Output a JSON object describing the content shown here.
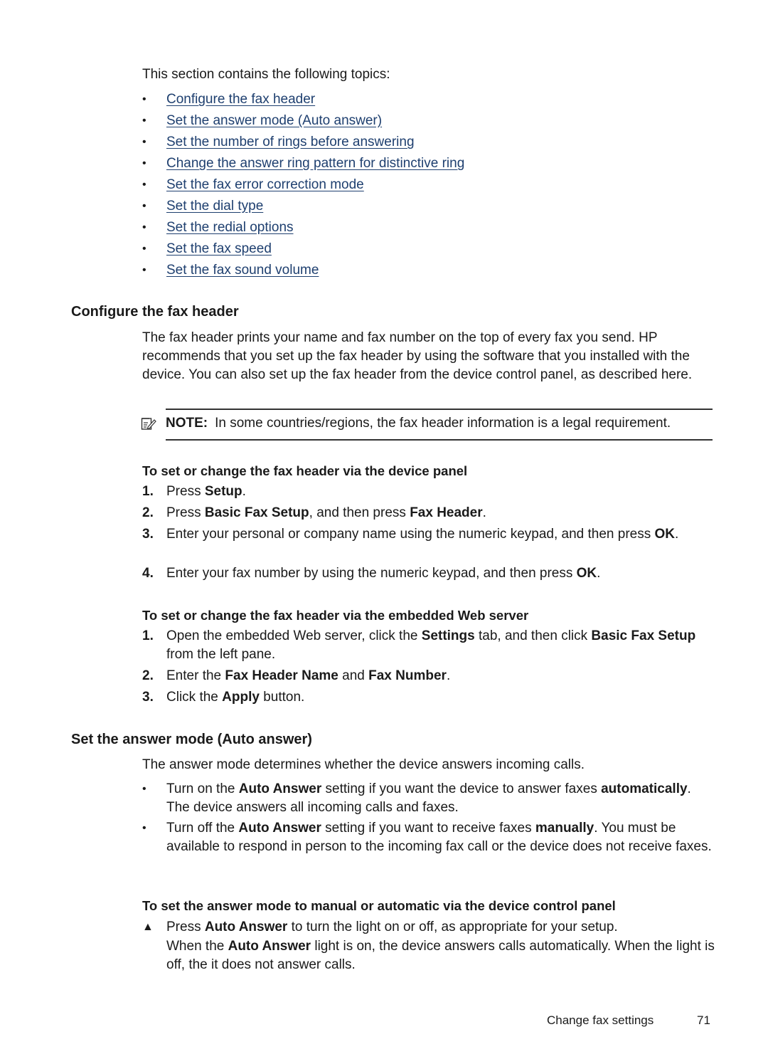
{
  "intro": "This section contains the following topics:",
  "topics": [
    {
      "bullet": "•",
      "label": "Configure the fax header"
    },
    {
      "bullet": "•",
      "label": "Set the answer mode (Auto answer)"
    },
    {
      "bullet": "•",
      "label": "Set the number of rings before answering"
    },
    {
      "bullet": "•",
      "label": "Change the answer ring pattern for distinctive ring"
    },
    {
      "bullet": "•",
      "label": "Set the fax error correction mode"
    },
    {
      "bullet": "•",
      "label": "Set the dial type"
    },
    {
      "bullet": "•",
      "label": "Set the redial options"
    },
    {
      "bullet": "•",
      "label": "Set the fax speed"
    },
    {
      "bullet": "•",
      "label": "Set the fax sound volume"
    }
  ],
  "section1": {
    "heading": "Configure the fax header",
    "body": "The fax header prints your name and fax number on the top of every fax you send. HP recommends that you set up the fax header by using the software that you installed with the device. You can also set up the fax header from the device control panel, as described here.",
    "note_label": "NOTE:",
    "note_text": "In some countries/regions, the fax header information is a legal requirement.",
    "note_icon": "note-pencil-icon",
    "proc1": {
      "title": "To set or change the fax header via the device panel",
      "steps": [
        {
          "num": "1.",
          "pre": "Press ",
          "b1": "Setup",
          "mid": ".",
          "b2": "",
          "post": ""
        },
        {
          "num": "2.",
          "pre": "Press ",
          "b1": "Basic Fax Setup",
          "mid": ", and then press ",
          "b2": "Fax Header",
          "post": "."
        },
        {
          "num": "3.",
          "pre": "Enter your personal or company name using the numeric keypad, and then press ",
          "b1": "OK",
          "mid": ".",
          "b2": "",
          "post": ""
        },
        {
          "num": "4.",
          "pre": "Enter your fax number by using the numeric keypad, and then press ",
          "b1": "OK",
          "mid": ".",
          "b2": "",
          "post": ""
        }
      ]
    },
    "proc2": {
      "title": "To set or change the fax header via the embedded Web server",
      "steps": [
        {
          "num": "1.",
          "pre": "Open the embedded Web server, click the ",
          "b1": "Settings",
          "mid": " tab, and then click ",
          "b2": "Basic Fax Setup",
          "post": " from the left pane."
        },
        {
          "num": "2.",
          "pre": "Enter the ",
          "b1": "Fax Header Name",
          "mid": " and ",
          "b2": "Fax Number",
          "post": "."
        },
        {
          "num": "3.",
          "pre": "Click the ",
          "b1": "Apply",
          "mid": " button.",
          "b2": "",
          "post": ""
        }
      ]
    }
  },
  "section2": {
    "heading": "Set the answer mode (Auto answer)",
    "body": "The answer mode determines whether the device answers incoming calls.",
    "bullets": [
      {
        "dot": "•",
        "pre": "Turn on the ",
        "b1": "Auto Answer",
        "mid": " setting if you want the device to answer faxes ",
        "b2": "automatically",
        "post": ". The device answers all incoming calls and faxes."
      },
      {
        "dot": "•",
        "pre": "Turn off the ",
        "b1": "Auto Answer",
        "mid": " setting if you want to receive faxes ",
        "b2": "manually",
        "post": ". You must be available to respond in person to the incoming fax call or the device does not receive faxes."
      }
    ],
    "proc": {
      "title": "To set the answer mode to manual or automatic via the device control panel",
      "marker": "▲",
      "step": {
        "pre": "Press ",
        "b1": "Auto Answer",
        "post": " to turn the light on or off, as appropriate for your setup."
      },
      "result": {
        "pre": "When the ",
        "b1": "Auto Answer",
        "post": " light is on, the device answers calls automatically. When the light is off, the it does not answer calls."
      }
    }
  },
  "footer": {
    "section": "Change fax settings",
    "page": "71"
  }
}
